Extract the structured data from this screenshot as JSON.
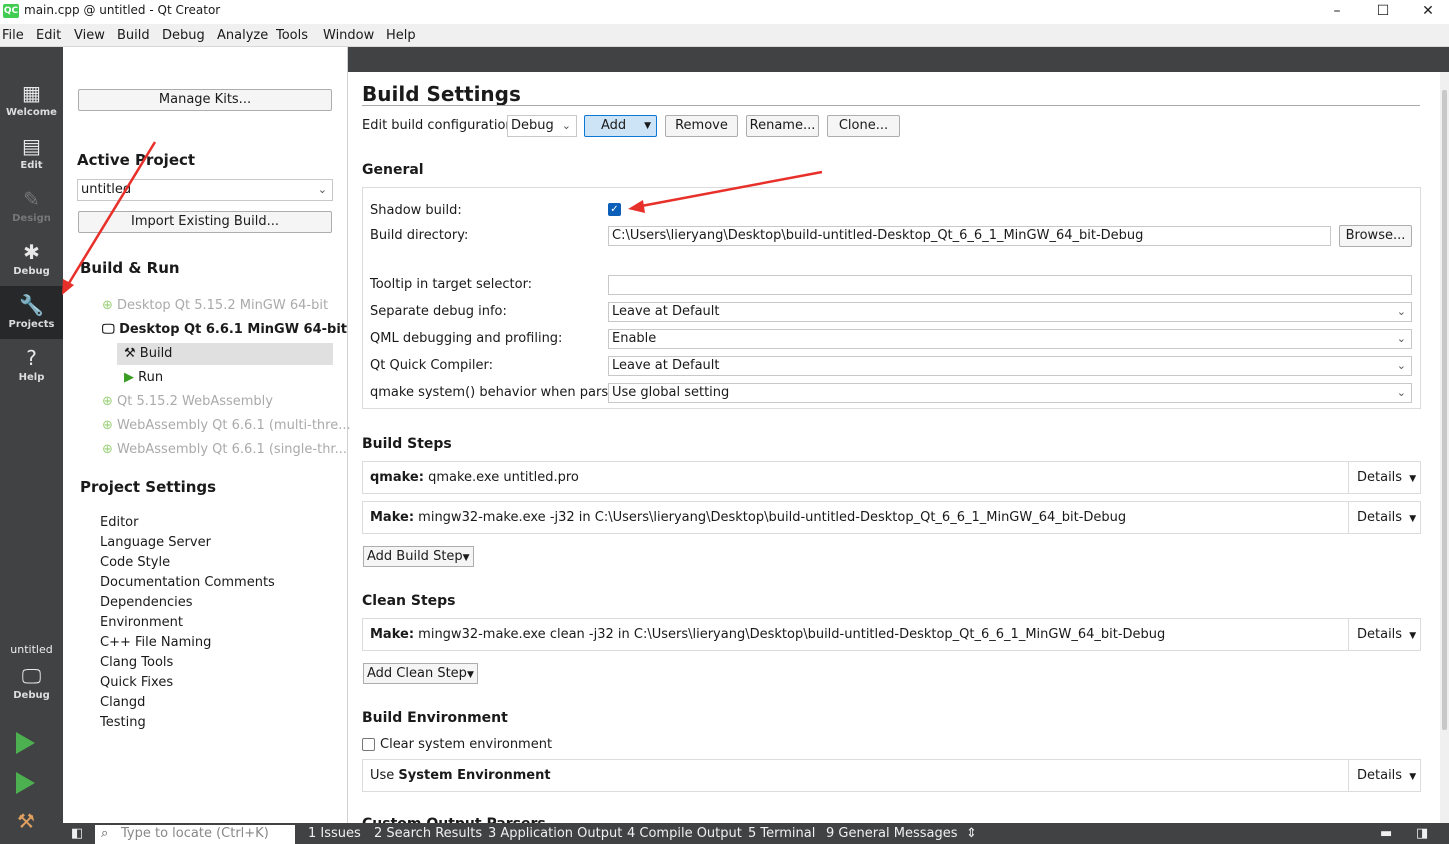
{
  "window": {
    "title": "main.cpp @ untitled - Qt Creator",
    "logo": "QC",
    "minimize": "–",
    "maximize": "☐",
    "close": "✕"
  },
  "menu": [
    "File",
    "Edit",
    "View",
    "Build",
    "Debug",
    "Analyze",
    "Tools",
    "Window",
    "Help"
  ],
  "modes": {
    "welcome": "Welcome",
    "edit": "Edit",
    "design": "Design",
    "debug": "Debug",
    "projects": "Projects",
    "help": "Help",
    "target_project": "untitled",
    "target_config": "Debug"
  },
  "left": {
    "manage_kits": "Manage Kits...",
    "active_project_heading": "Active Project",
    "active_project_value": "untitled",
    "import_build": "Import Existing Build...",
    "build_run_heading": "Build & Run",
    "kits": [
      {
        "label": "Desktop Qt 5.15.2 MinGW 64-bit"
      },
      {
        "label": "Desktop Qt 6.6.1 MinGW 64-bit"
      },
      {
        "label": "Build"
      },
      {
        "label": "Run"
      },
      {
        "label": "Qt 5.15.2 WebAssembly"
      },
      {
        "label": "WebAssembly Qt 6.6.1 (multi-thre..."
      },
      {
        "label": "WebAssembly Qt 6.6.1 (single-thr..."
      }
    ],
    "project_settings_heading": "Project Settings",
    "project_settings": [
      "Editor",
      "Language Server",
      "Code Style",
      "Documentation Comments",
      "Dependencies",
      "Environment",
      "C++ File Naming",
      "Clang Tools",
      "Quick Fixes",
      "Clangd",
      "Testing"
    ]
  },
  "main": {
    "title": "Build Settings",
    "edit_config_label": "Edit build configuration:",
    "config_value": "Debug",
    "add": "Add",
    "remove": "Remove",
    "rename": "Rename...",
    "clone": "Clone...",
    "general_heading": "General",
    "shadow_build_label": "Shadow build:",
    "build_dir_label": "Build directory:",
    "build_dir_value": "C:\\Users\\lieryang\\Desktop\\build-untitled-Desktop_Qt_6_6_1_MinGW_64_bit-Debug",
    "browse": "Browse...",
    "tooltip_label": "Tooltip in target selector:",
    "tooltip_value": "",
    "sep_debug_label": "Separate debug info:",
    "sep_debug_value": "Leave at Default",
    "qml_debug_label": "QML debugging and profiling:",
    "qml_debug_value": "Enable",
    "quick_compiler_label": "Qt Quick Compiler:",
    "quick_compiler_value": "Leave at Default",
    "qmake_system_label": "qmake system() behavior when parsing:",
    "qmake_system_value": "Use global setting",
    "build_steps_heading": "Build Steps",
    "qmake_step_bold": "qmake:",
    "qmake_step_text": " qmake.exe untitled.pro",
    "make_step_bold": "Make:",
    "make_step_text": " mingw32-make.exe -j32 in C:\\Users\\lieryang\\Desktop\\build-untitled-Desktop_Qt_6_6_1_MinGW_64_bit-Debug",
    "details": "Details",
    "add_build_step": "Add Build Step",
    "clean_steps_heading": "Clean Steps",
    "clean_step_bold": "Make:",
    "clean_step_text": " mingw32-make.exe clean -j32 in C:\\Users\\lieryang\\Desktop\\build-untitled-Desktop_Qt_6_6_1_MinGW_64_bit-Debug",
    "add_clean_step": "Add Clean Step",
    "build_env_heading": "Build Environment",
    "clear_env_label": "Clear system environment",
    "use_env_prefix": "Use ",
    "use_env_bold": "System Environment",
    "custom_parsers_heading": "Custom Output Parsers"
  },
  "status": {
    "locator_placeholder": "Type to locate (Ctrl+K)",
    "panes": [
      "1  Issues",
      "2  Search Results",
      "3  Application Output",
      "4  Compile Output",
      "5  Terminal",
      "9  General Messages"
    ]
  },
  "colors": {
    "sidebar": "#404244",
    "sidebar_active": "#262829",
    "accent_blue": "#0b5fb8",
    "arrow_red": "#e8302a",
    "run_green": "#4caf50"
  }
}
